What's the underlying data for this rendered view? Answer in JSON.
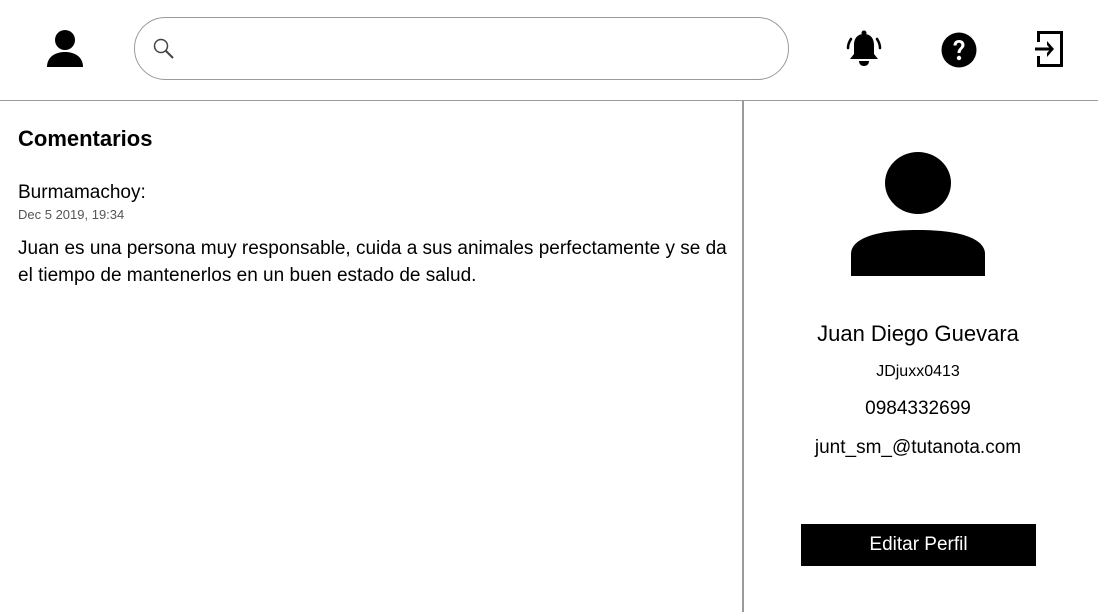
{
  "header": {
    "search": {
      "value": "",
      "placeholder": ""
    },
    "icons": {
      "user": "user-icon",
      "search": "search-icon",
      "notifications": "bell-icon",
      "help": "help-icon",
      "logout": "logout-icon"
    }
  },
  "comments": {
    "title": "Comentarios",
    "items": [
      {
        "author": "Burmamachoy:",
        "date": "Dec 5 2019, 19:34",
        "text": "Juan es una persona muy responsable, cuida a sus animales perfectamente y se da el tiempo de mantenerlos en un buen estado de salud."
      }
    ]
  },
  "profile": {
    "avatar_icon": "avatar-icon",
    "name": "Juan Diego Guevara",
    "username": "JDjuxx0413",
    "phone": "0984332699",
    "email": "junt_sm_@tutanota.com",
    "edit_label": "Editar Perfil"
  }
}
